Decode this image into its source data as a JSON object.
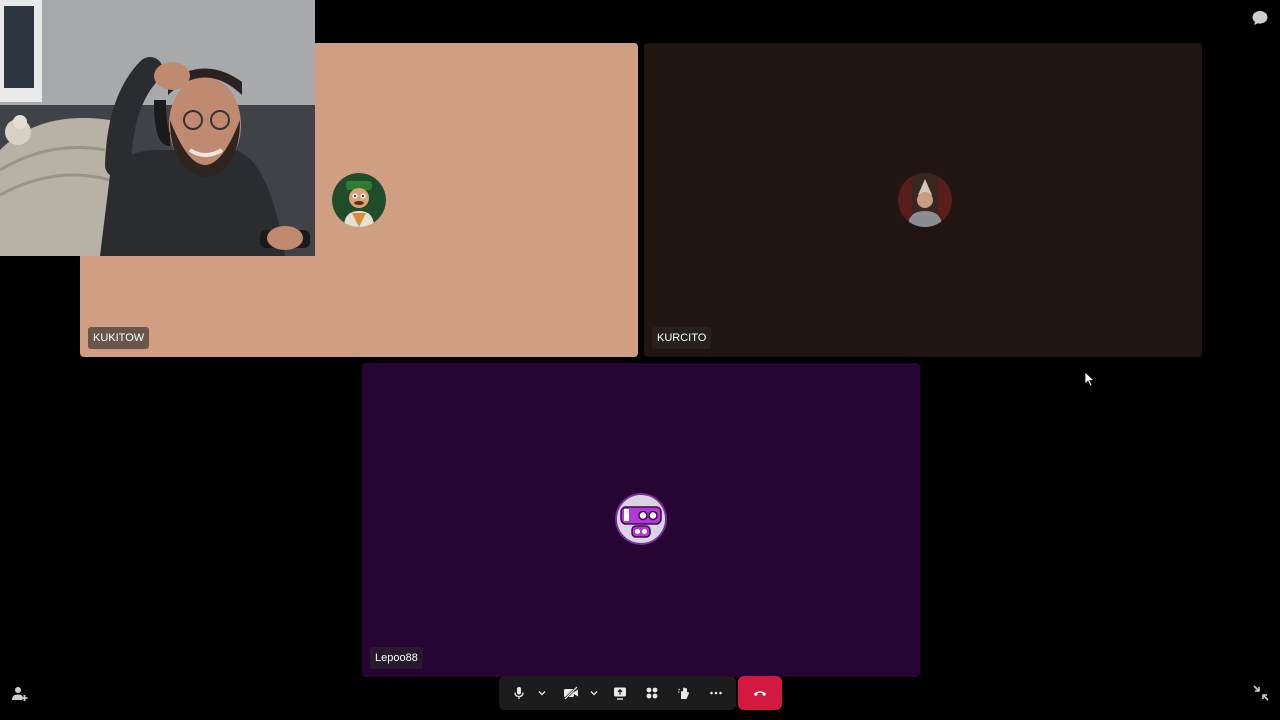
{
  "participants": [
    {
      "name": "KUKITOW",
      "background": "#d09f83",
      "avatar": "cartoon-chef-avatar"
    },
    {
      "name": "KURCITO",
      "background": "#211512",
      "avatar": "person-photo-avatar"
    },
    {
      "name": "Lepoo88",
      "background": "#260535",
      "avatar": "lepoo88-logo-avatar"
    }
  ],
  "colors": {
    "background": "#000000",
    "toolbar": "#1c1c1c",
    "hangup": "#d21a3f",
    "name_tag": "rgba(40,40,40,0.62)"
  },
  "icons": {
    "top_right": "chat-icon",
    "bottom_left": "participants-icon",
    "bottom_right": "exit-fullscreen-icon",
    "toolbar": [
      "microphone-icon",
      "chevron-down-icon",
      "camera-off-icon",
      "chevron-down-icon",
      "screen-share-icon",
      "tile-view-icon",
      "raise-hand-icon",
      "more-icon",
      "hang-up-icon"
    ]
  }
}
